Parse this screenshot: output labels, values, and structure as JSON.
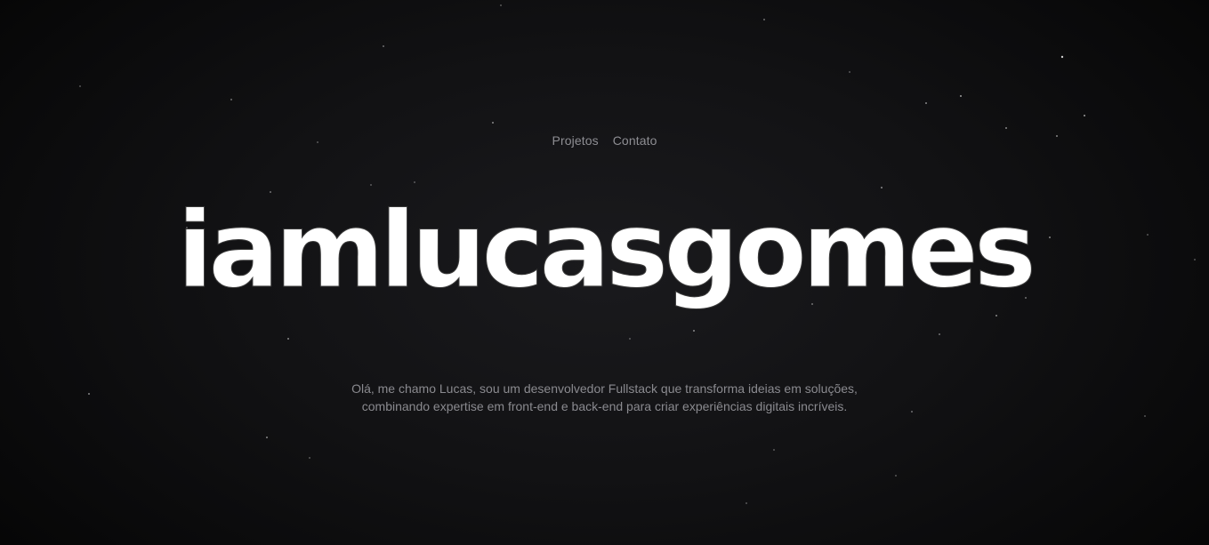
{
  "nav": {
    "items": [
      {
        "label": "Projetos"
      },
      {
        "label": "Contato"
      }
    ]
  },
  "hero": {
    "title": "iamlucasgomes",
    "description_line1": "Olá, me chamo Lucas, sou um desenvolvedor Fullstack que transforma ideias em soluções,",
    "description_line2": "combinando expertise em front-end e back-end para criar experiências digitais incríveis."
  },
  "colors": {
    "background": "#0b0b0c",
    "nav_text": "#8e8e93",
    "title": "#ffffff",
    "description": "#8a8a8f"
  }
}
